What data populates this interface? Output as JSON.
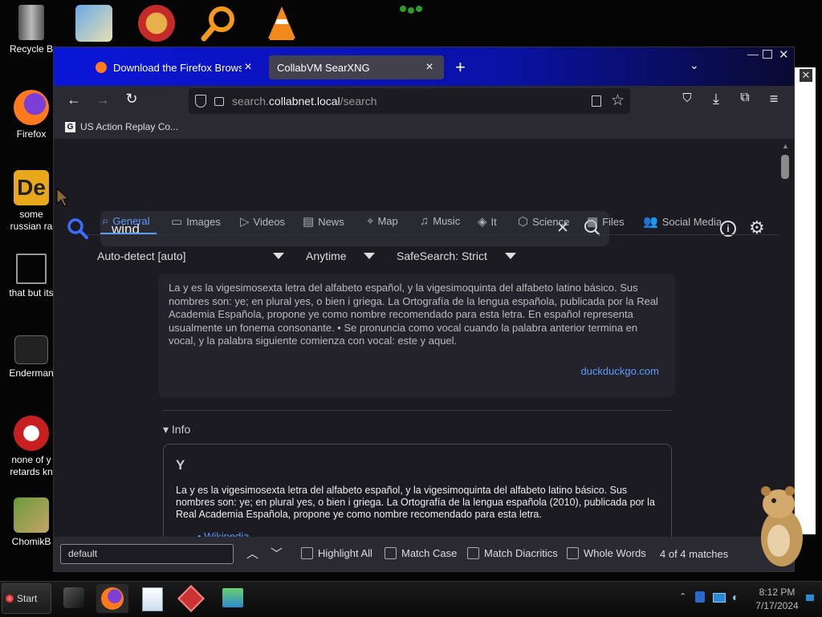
{
  "desktop": {
    "icons": [
      {
        "label": "Recycle B"
      },
      {
        "label": "Firefox"
      },
      {
        "label": "some russian ra"
      },
      {
        "label": "that but its"
      },
      {
        "label": "Enderman"
      },
      {
        "label": "none of y retards kn"
      },
      {
        "label": "ChomikB"
      }
    ]
  },
  "browser": {
    "tabs": [
      {
        "title": "Download the Firefox Browser"
      },
      {
        "title": "CollabVM SearXNG"
      }
    ],
    "url_prefix": "search.",
    "url_host": "collabnet.local",
    "url_path": "/search",
    "bookmark": "US Action Replay Co..."
  },
  "search": {
    "query": "wind",
    "categories": [
      "General",
      "Images",
      "Videos",
      "News",
      "Map",
      "Music",
      "It",
      "Science",
      "Files",
      "Social Media"
    ],
    "filters": {
      "language": "Auto-detect [auto]",
      "time": "Anytime",
      "safesearch": "SafeSearch: Strict"
    }
  },
  "answer": {
    "text": "La y es la vigesimosexta letra del alfabeto español, y la vigesimoquinta del alfabeto latino básico. Sus nombres son: ye; en plural yes, o bien i griega. La Ortografía de la lengua española, publicada por la Real Academia Española, propone ye como nombre recomendado para esta letra. En español representa usualmente un fonema consonante. • Se pronuncia como vocal cuando la palabra anterior termina en vocal, y la palabra siguiente comienza con vocal: este y aquel.",
    "source": "duckduckgo.com"
  },
  "info": {
    "header": "Info",
    "title": "Y",
    "text": "La y es la vigesimosexta letra del alfabeto español, y la vigesimoquinta del alfabeto latino básico. Sus nombres son: ye; en plural yes, o bien i griega. La Ortografía de la lengua española (2010), publicada por la Real Academia Española, propone ye como nombre recomendado para esta letra.",
    "link": "Wikipedia"
  },
  "find": {
    "value": "default",
    "highlight_all": "Highlight All",
    "match_case": "Match Case",
    "match_diacritics": "Match Diacritics",
    "whole_words": "Whole Words",
    "result": "4 of 4 matches"
  },
  "taskbar": {
    "start": "Start",
    "time": "8:12 PM",
    "date": "7/17/2024"
  },
  "colors": {
    "accent": "#3d6cff",
    "link": "#5a9cf8",
    "tab_active": "#42414d"
  }
}
